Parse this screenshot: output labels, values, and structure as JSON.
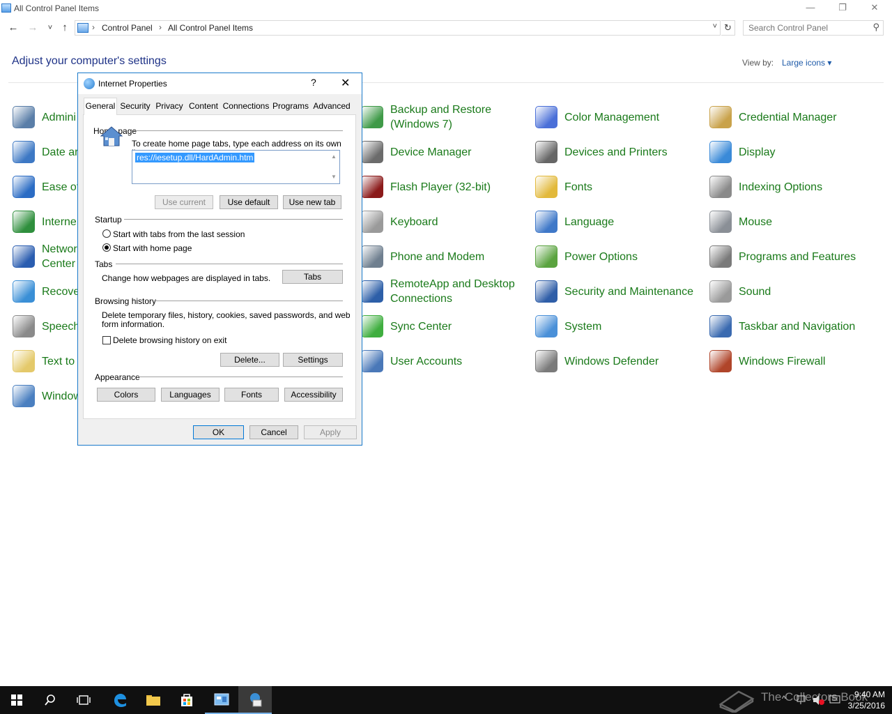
{
  "window": {
    "title": "All Control Panel Items",
    "minimize_glyph": "—",
    "restore_glyph": "❐",
    "close_glyph": "✕"
  },
  "nav": {
    "back_glyph": "←",
    "forward_glyph": "→",
    "recent_glyph": "˅",
    "up_glyph": "↑",
    "breadcrumb": [
      "Control Panel",
      "All Control Panel Items"
    ],
    "breadcrumb_sep": "›",
    "dropdown_glyph": "˅",
    "refresh_glyph": "↻",
    "search_placeholder": "Search Control Panel",
    "search_glyph": "⚲"
  },
  "main": {
    "heading": "Adjust your computer's settings",
    "view_by_label": "View by:",
    "view_by_value": "Large icons ▾"
  },
  "items_col1": [
    {
      "label": "Admini",
      "icon": "administrative-tools-icon",
      "color": "#5a7ea8"
    },
    {
      "label": "Date ar",
      "icon": "date-time-icon",
      "color": "#3d78c4"
    },
    {
      "label": "Ease of",
      "icon": "ease-of-access-icon",
      "color": "#2b6cc4"
    },
    {
      "label": "Interne",
      "icon": "internet-options-icon",
      "color": "#2f8f3d"
    },
    {
      "label": "Networ",
      "label2": "Center",
      "icon": "network-center-icon",
      "color": "#2a5db0"
    },
    {
      "label": "Recove",
      "icon": "recovery-icon",
      "color": "#3a8fd6"
    },
    {
      "label": "Speech",
      "icon": "speech-icon",
      "color": "#8a8a8a"
    },
    {
      "label": "Text to",
      "icon": "text-to-speech-icon",
      "color": "#e4c96a"
    },
    {
      "label": "Window",
      "icon": "windows-to-go-icon",
      "color": "#4a7fc0"
    }
  ],
  "items_col2": [
    {
      "label": "Backup and Restore",
      "label2": "(Windows 7)",
      "icon": "backup-restore-icon",
      "color": "#3f9a48"
    },
    {
      "label": "Device Manager",
      "icon": "device-manager-icon",
      "color": "#6b6b6b"
    },
    {
      "label": "Flash Player (32-bit)",
      "icon": "flash-player-icon",
      "color": "#8b1a1a"
    },
    {
      "label": "Keyboard",
      "icon": "keyboard-icon",
      "color": "#9a9a9a"
    },
    {
      "label": "Phone and Modem",
      "icon": "phone-modem-icon",
      "color": "#6f7f8f"
    },
    {
      "label": "RemoteApp and Desktop",
      "label2": "Connections",
      "icon": "remoteapp-icon",
      "color": "#2d5fa8"
    },
    {
      "label": "Sync Center",
      "icon": "sync-center-icon",
      "color": "#3fae3f"
    },
    {
      "label": "User Accounts",
      "icon": "user-accounts-icon",
      "color": "#4a78b8"
    }
  ],
  "items_col3": [
    {
      "label": "Color Management",
      "icon": "color-management-icon",
      "color": "#4a6fd8"
    },
    {
      "label": "Devices and Printers",
      "icon": "devices-printers-icon",
      "color": "#666666"
    },
    {
      "label": "Fonts",
      "icon": "fonts-icon",
      "color": "#e2b93b"
    },
    {
      "label": "Language",
      "icon": "language-icon",
      "color": "#3f78c8"
    },
    {
      "label": "Power Options",
      "icon": "power-options-icon",
      "color": "#5aa33f"
    },
    {
      "label": "Security and Maintenance",
      "icon": "security-maintenance-icon",
      "color": "#2f5ea8"
    },
    {
      "label": "System",
      "icon": "system-icon",
      "color": "#4a90d8"
    },
    {
      "label": "Windows Defender",
      "icon": "windows-defender-icon",
      "color": "#7a7a7a"
    }
  ],
  "items_col4": [
    {
      "label": "Credential Manager",
      "icon": "credential-manager-icon",
      "color": "#c9a24a"
    },
    {
      "label": "Display",
      "icon": "display-icon",
      "color": "#3a8ad8"
    },
    {
      "label": "Indexing Options",
      "icon": "indexing-options-icon",
      "color": "#8a8a8a"
    },
    {
      "label": "Mouse",
      "icon": "mouse-icon",
      "color": "#8a8f96"
    },
    {
      "label": "Programs and Features",
      "icon": "programs-features-icon",
      "color": "#7a7a7a"
    },
    {
      "label": "Sound",
      "icon": "sound-icon",
      "color": "#9a9a9a"
    },
    {
      "label": "Taskbar and Navigation",
      "icon": "taskbar-navigation-icon",
      "color": "#3a6ab0"
    },
    {
      "label": "Windows Firewall",
      "icon": "windows-firewall-icon",
      "color": "#b0452a"
    }
  ],
  "dialog": {
    "title": "Internet Properties",
    "help_glyph": "?",
    "close_glyph": "✕",
    "tabs": [
      "General",
      "Security",
      "Privacy",
      "Content",
      "Connections",
      "Programs",
      "Advanced"
    ],
    "home_page": {
      "group": "Home page",
      "instruction": "To create home page tabs, type each address on its own line.",
      "url": "res://iesetup.dll/HardAdmin.htm",
      "btn_use_current": "Use current",
      "btn_use_default": "Use default",
      "btn_use_new_tab": "Use new tab"
    },
    "startup": {
      "group": "Startup",
      "option1": "Start with tabs from the last session",
      "option2": "Start with home page"
    },
    "tabs_group": {
      "group": "Tabs",
      "text": "Change how webpages are displayed in tabs.",
      "btn": "Tabs"
    },
    "history": {
      "group": "Browsing history",
      "text1": "Delete temporary files, history, cookies, saved passwords, and web",
      "text2": "form information.",
      "checkbox": "Delete browsing history on exit",
      "btn_delete": "Delete...",
      "btn_settings": "Settings"
    },
    "appearance": {
      "group": "Appearance",
      "btn_colors": "Colors",
      "btn_languages": "Languages",
      "btn_fonts": "Fonts",
      "btn_accessibility": "Accessibility"
    },
    "btn_ok": "OK",
    "btn_cancel": "Cancel",
    "btn_apply": "Apply"
  },
  "taskbar": {
    "time": "9:40 AM",
    "date": "3/25/2016",
    "watermark": "The Collectors Book"
  },
  "colors": {
    "accent": "#0078d7",
    "link_green": "#1a7a1a",
    "heading_blue": "#1e3287",
    "taskbar": "#101010"
  }
}
